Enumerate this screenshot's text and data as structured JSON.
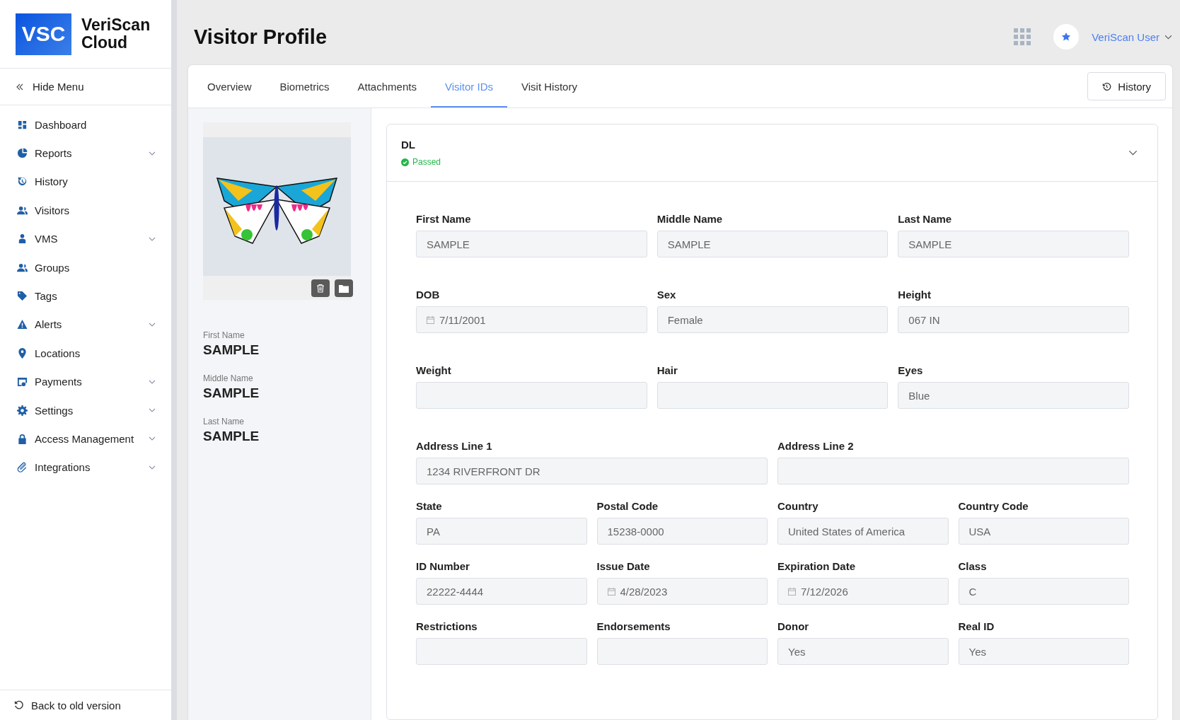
{
  "logo": {
    "mark": "VSC",
    "name_line1": "VeriScan",
    "name_line2": "Cloud"
  },
  "hide_menu": "Hide Menu",
  "sidebar": {
    "items": [
      {
        "label": "Dashboard",
        "has_submenu": false
      },
      {
        "label": "Reports",
        "has_submenu": true
      },
      {
        "label": "History",
        "has_submenu": false
      },
      {
        "label": "Visitors",
        "has_submenu": false
      },
      {
        "label": "VMS",
        "has_submenu": true
      },
      {
        "label": "Groups",
        "has_submenu": false
      },
      {
        "label": "Tags",
        "has_submenu": false
      },
      {
        "label": "Alerts",
        "has_submenu": true
      },
      {
        "label": "Locations",
        "has_submenu": false
      },
      {
        "label": "Payments",
        "has_submenu": true
      },
      {
        "label": "Settings",
        "has_submenu": true
      },
      {
        "label": "Access Management",
        "has_submenu": true
      },
      {
        "label": "Integrations",
        "has_submenu": true
      }
    ]
  },
  "back_link": "Back to old version",
  "page_title": "Visitor Profile",
  "user": {
    "name": "VeriScan User"
  },
  "tabs": [
    {
      "label": "Overview",
      "selected": false
    },
    {
      "label": "Biometrics",
      "selected": false
    },
    {
      "label": "Attachments",
      "selected": false
    },
    {
      "label": "Visitor IDs",
      "selected": true
    },
    {
      "label": "Visit History",
      "selected": false
    }
  ],
  "history_button": "History",
  "profile": {
    "fields": [
      {
        "label": "First Name",
        "value": "SAMPLE"
      },
      {
        "label": "Middle Name",
        "value": "SAMPLE"
      },
      {
        "label": "Last Name",
        "value": "SAMPLE"
      }
    ]
  },
  "id_card": {
    "title": "DL",
    "status": "Passed",
    "passed": true,
    "expanded": true,
    "rows": [
      {
        "fields": [
          {
            "label": "First Name",
            "kind": "text",
            "value": "SAMPLE"
          },
          {
            "label": "Middle Name",
            "kind": "text",
            "value": "SAMPLE"
          },
          {
            "label": "Last Name",
            "kind": "text",
            "value": "SAMPLE"
          }
        ]
      },
      {
        "fields": [
          {
            "label": "DOB",
            "kind": "date",
            "value": "7/11/2001"
          },
          {
            "label": "Sex",
            "kind": "text",
            "value": "Female"
          },
          {
            "label": "Height",
            "kind": "text",
            "value": "067 IN"
          }
        ]
      },
      {
        "fields": [
          {
            "label": "Weight",
            "kind": "text"
          },
          {
            "label": "Hair",
            "kind": "text"
          },
          {
            "label": "Eyes",
            "kind": "text",
            "value": "Blue"
          }
        ]
      },
      {
        "fields": [
          {
            "label": "Address Line 1",
            "kind": "text",
            "value": "1234 RIVERFRONT DR"
          },
          {
            "label": "Address Line 2",
            "kind": "text"
          }
        ]
      },
      {
        "fields": [
          {
            "label": "State",
            "kind": "text",
            "value": "PA"
          },
          {
            "label": "Postal Code",
            "kind": "text",
            "value": "15238-0000"
          },
          {
            "label": "Country",
            "kind": "text",
            "value": "United States of America"
          },
          {
            "label": "Country Code",
            "kind": "text",
            "value": "USA"
          }
        ]
      },
      {
        "fields": [
          {
            "label": "ID Number",
            "kind": "text",
            "value": "22222-4444"
          },
          {
            "label": "Issue Date",
            "kind": "date",
            "value": "4/28/2023"
          },
          {
            "label": "Expiration Date",
            "kind": "date",
            "value": "7/12/2026"
          },
          {
            "label": "Class",
            "kind": "text",
            "value": "C"
          }
        ]
      },
      {
        "fields": [
          {
            "label": "Restrictions",
            "kind": "text"
          },
          {
            "label": "Endorsements",
            "kind": "text"
          },
          {
            "label": "Donor",
            "kind": "text",
            "value": "Yes"
          },
          {
            "label": "Real ID",
            "kind": "text",
            "value": "Yes"
          }
        ]
      }
    ]
  }
}
